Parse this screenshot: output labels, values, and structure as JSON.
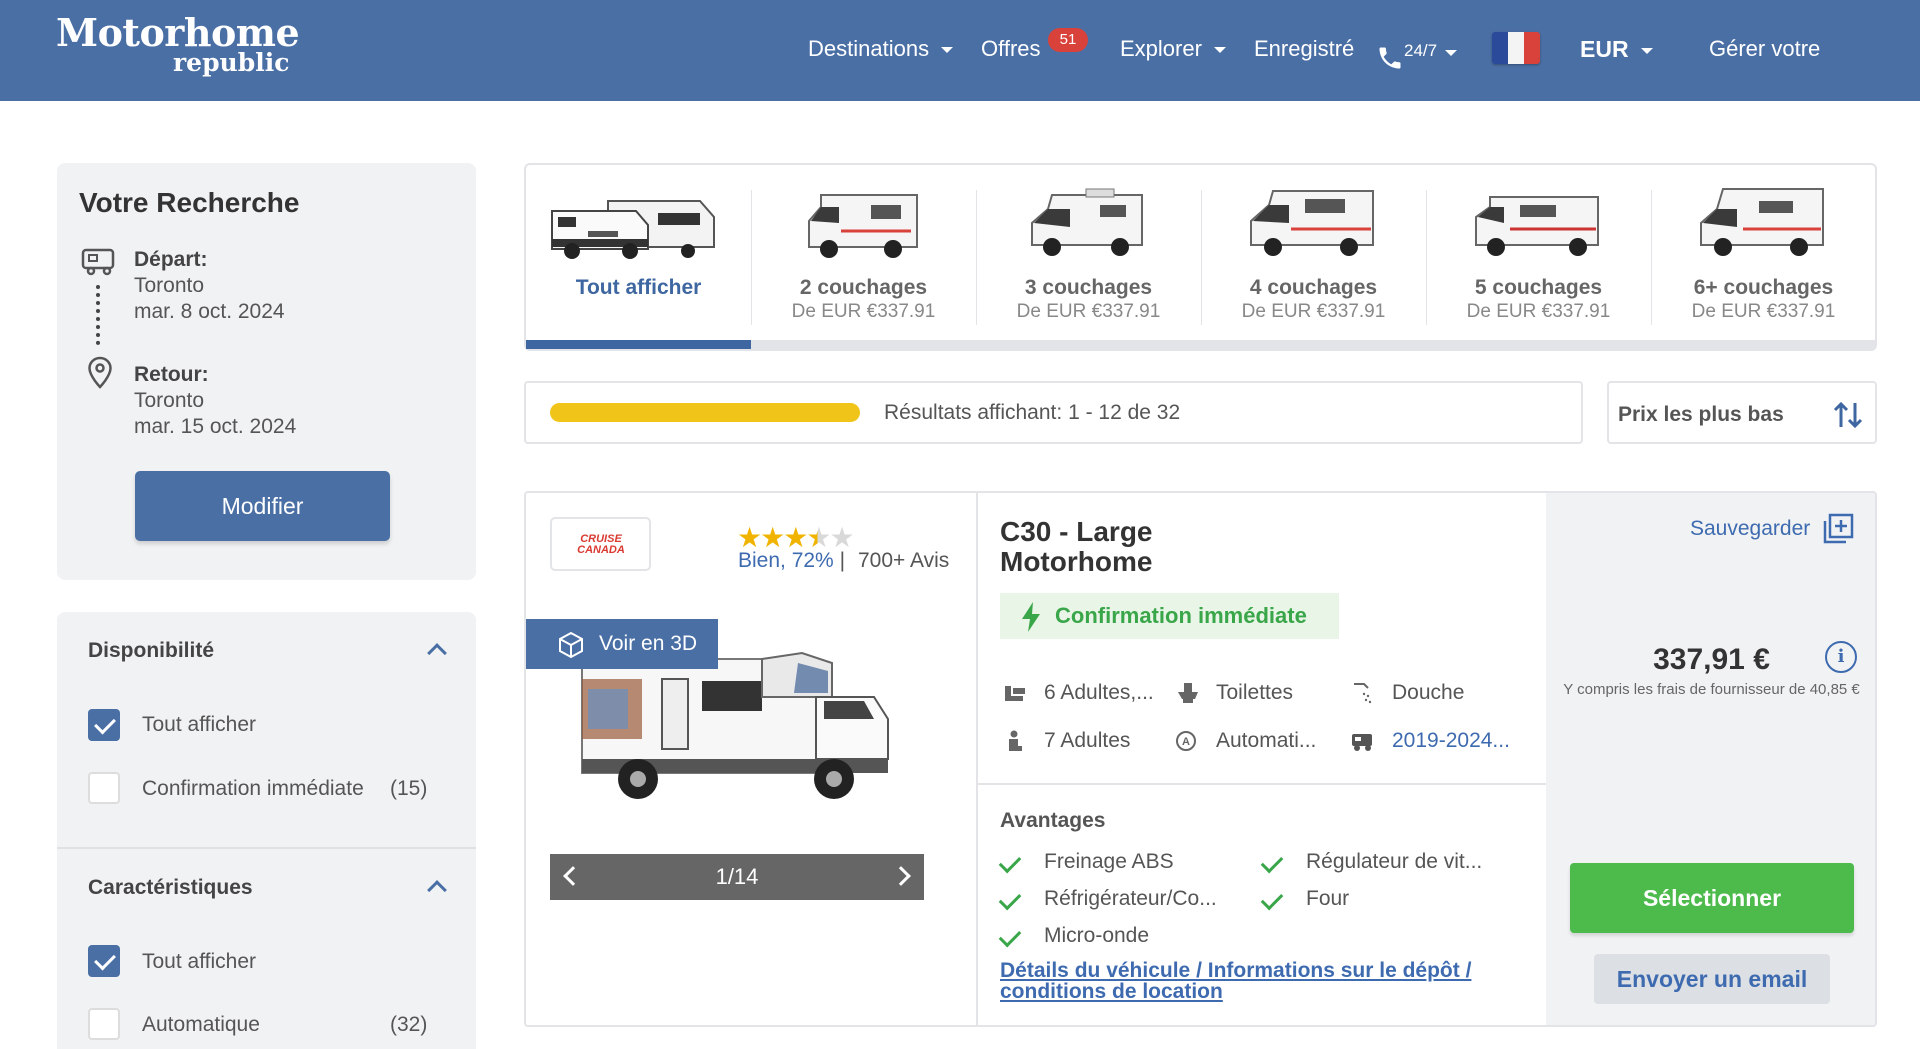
{
  "header": {
    "logo_line1": "Motorhome",
    "logo_line2": "republic",
    "nav": {
      "destinations": "Destinations",
      "offres": "Offres",
      "offres_badge": "51",
      "explorer": "Explorer",
      "enregistre": "Enregistré",
      "phone": "24/7",
      "currency": "EUR",
      "gerer": "Gérer votre"
    }
  },
  "search": {
    "title": "Votre Recherche",
    "depart_label": "Départ:",
    "depart_city": "Toronto",
    "depart_date": "mar. 8 oct. 2024",
    "retour_label": "Retour:",
    "retour_city": "Toronto",
    "retour_date": "mar. 15 oct. 2024",
    "modify_button": "Modifier"
  },
  "filters": {
    "availability_title": "Disponibilité",
    "availability_all": "Tout afficher",
    "availability_instant": "Confirmation immédiate",
    "availability_instant_count": "(15)",
    "features_title": "Caractéristiques",
    "features_all": "Tout afficher",
    "features_auto": "Automatique",
    "features_auto_count": "(32)"
  },
  "categories": [
    {
      "name": "Tout afficher",
      "price": ""
    },
    {
      "name": "2 couchages",
      "price": "De EUR €337.91"
    },
    {
      "name": "3 couchages",
      "price": "De EUR €337.91"
    },
    {
      "name": "4 couchages",
      "price": "De EUR €337.91"
    },
    {
      "name": "5 couchages",
      "price": "De EUR €337.91"
    },
    {
      "name": "6+ couchages",
      "price": "De EUR €337.91"
    }
  ],
  "results": {
    "label": "Résultats affichant:",
    "range": "1 - 12 de 32",
    "sort_label": "Prix les plus bas"
  },
  "listing": {
    "brand": "CRUISE CANADA",
    "rating_text": "Bien, 72%",
    "rating_sep": " |",
    "reviews": "700+ Avis",
    "stars_value": 3.5,
    "voir3d": "Voir en 3D",
    "gallery_counter": "1/14",
    "title_line1": "C30 - Large",
    "title_line2": "Motorhome",
    "confirmation": "Confirmation immédiate",
    "features": {
      "seats": "6 Adultes,...",
      "toilet": "Toilettes",
      "shower": "Douche",
      "sleep": "7 Adultes",
      "transmission": "Automati...",
      "year": "2019-2024..."
    },
    "advantages_title": "Avantages",
    "advantages": {
      "a1": "Freinage ABS",
      "a2": "Régulateur de vit...",
      "a3": "Réfrigérateur/Co...",
      "a4": "Four",
      "a5": "Micro-onde"
    },
    "details_link": "Détails du véhicule / Informations sur le dépôt / conditions de location",
    "save": "Sauvegarder",
    "price": "337,91 €",
    "price_note": "Y compris les frais de fournisseur de 40,85 €",
    "select_button": "Sélectionner",
    "email_button": "Envoyer un email"
  },
  "colors": {
    "brand_blue": "#4a6fa5",
    "green": "#4cbb4c",
    "progress_yellow": "#f0c419"
  }
}
